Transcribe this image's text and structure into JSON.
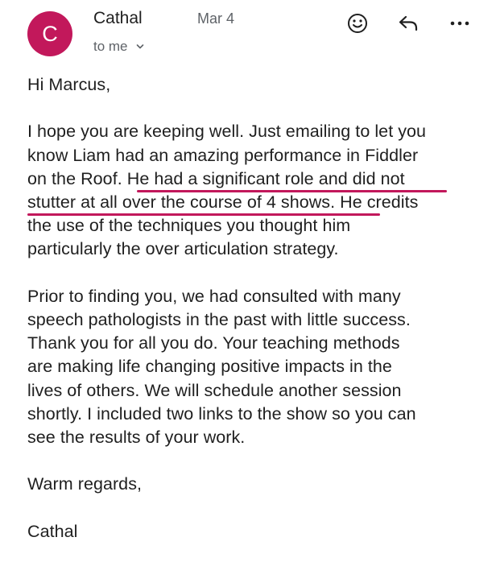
{
  "header": {
    "avatar_letter": "C",
    "avatar_color": "#c2185b",
    "sender": "Cathal",
    "date": "Mar 4",
    "recipient": "to me",
    "actions": [
      "emoji-reaction-icon",
      "reply-icon",
      "more-options-icon"
    ]
  },
  "body": {
    "greeting": "Hi Marcus,",
    "p1_line1": "I hope you are keeping well. Just emailing to let you",
    "p1_line2": "know Liam had an amazing performance in Fiddler",
    "p1_line3_pre": "on the Roof. ",
    "p1_highlight_a": "He had a significant role and did not",
    "p1_highlight_b": "stutter at all over the course of 4 shows.",
    "p1_line4_post": " He credits",
    "p1_line5": "the use of the techniques you thought him",
    "p1_line6": "particularly the over articulation strategy.",
    "p2": "Prior to finding you, we had consulted with many\nspeech pathologists in the past with little success.\nThank you for all you do. Your teaching methods\nare making life changing positive impacts in the\nlives of others.  We will schedule another session\nshortly. I included two links to the show so you can\nsee the results of your work.",
    "closing": "Warm regards,",
    "signature": "Cathal",
    "highlight_color": "#c2185b"
  }
}
